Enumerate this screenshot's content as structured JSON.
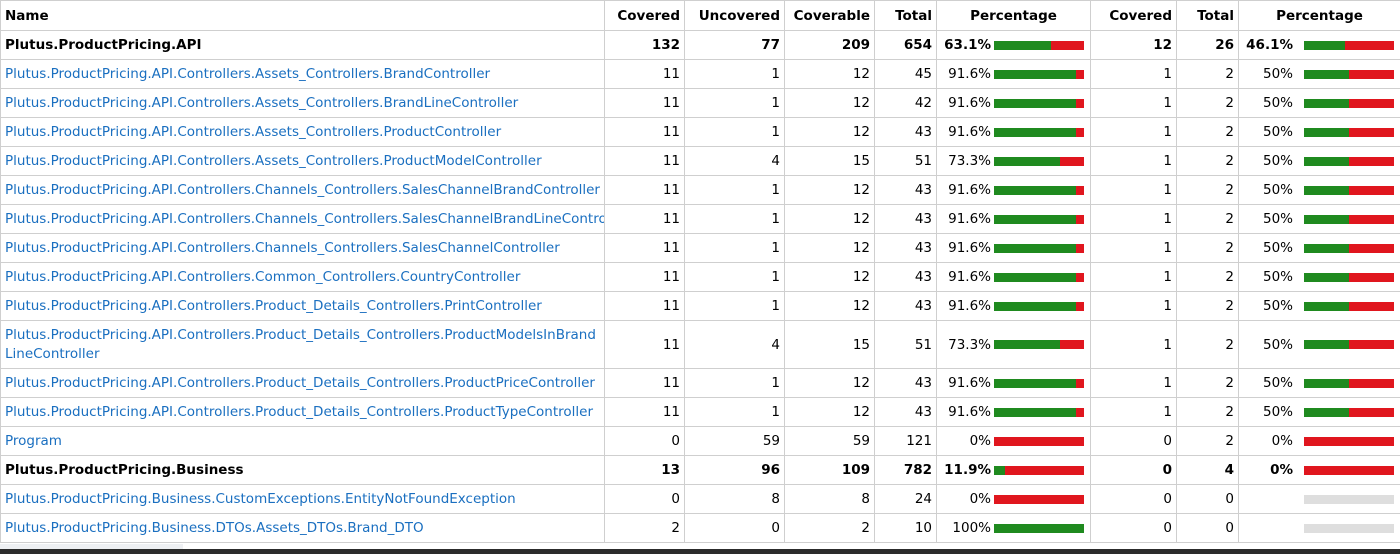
{
  "colors": {
    "covered": "#1f8a1f",
    "uncovered": "#e0161e",
    "link": "#1a6fc0",
    "empty": "#dedede"
  },
  "headers": [
    "Name",
    "Covered",
    "Uncovered",
    "Coverable",
    "Total",
    "Percentage",
    "Covered",
    "Total",
    "Percentage"
  ],
  "rows": [
    {
      "type": "assembly",
      "name": "Plutus.ProductPricing.API",
      "covered": "132",
      "uncovered": "77",
      "coverable": "209",
      "total": "654",
      "pct": "63.1%",
      "pct_value": 63.1,
      "b_covered": "12",
      "b_total": "26",
      "b_pct": "46.1%",
      "b_pct_value": 46.1
    },
    {
      "type": "class",
      "name": "Plutus.ProductPricing.API.Controllers.Assets_Controllers.BrandController",
      "covered": "11",
      "uncovered": "1",
      "coverable": "12",
      "total": "45",
      "pct": "91.6%",
      "pct_value": 91.6,
      "b_covered": "1",
      "b_total": "2",
      "b_pct": "50%",
      "b_pct_value": 50
    },
    {
      "type": "class",
      "name": "Plutus.ProductPricing.API.Controllers.Assets_Controllers.BrandLineController",
      "covered": "11",
      "uncovered": "1",
      "coverable": "12",
      "total": "42",
      "pct": "91.6%",
      "pct_value": 91.6,
      "b_covered": "1",
      "b_total": "2",
      "b_pct": "50%",
      "b_pct_value": 50
    },
    {
      "type": "class",
      "name": "Plutus.ProductPricing.API.Controllers.Assets_Controllers.ProductController",
      "covered": "11",
      "uncovered": "1",
      "coverable": "12",
      "total": "43",
      "pct": "91.6%",
      "pct_value": 91.6,
      "b_covered": "1",
      "b_total": "2",
      "b_pct": "50%",
      "b_pct_value": 50
    },
    {
      "type": "class",
      "name": "Plutus.ProductPricing.API.Controllers.Assets_Controllers.ProductModelController",
      "covered": "11",
      "uncovered": "4",
      "coverable": "15",
      "total": "51",
      "pct": "73.3%",
      "pct_value": 73.3,
      "b_covered": "1",
      "b_total": "2",
      "b_pct": "50%",
      "b_pct_value": 50
    },
    {
      "type": "class",
      "name": "Plutus.ProductPricing.API.Controllers.Channels_Controllers.SalesChannelBrandController",
      "covered": "11",
      "uncovered": "1",
      "coverable": "12",
      "total": "43",
      "pct": "91.6%",
      "pct_value": 91.6,
      "b_covered": "1",
      "b_total": "2",
      "b_pct": "50%",
      "b_pct_value": 50
    },
    {
      "type": "class",
      "name": "Plutus.ProductPricing.API.Controllers.Channels_Controllers.SalesChannelBrandLineController",
      "covered": "11",
      "uncovered": "1",
      "coverable": "12",
      "total": "43",
      "pct": "91.6%",
      "pct_value": 91.6,
      "b_covered": "1",
      "b_total": "2",
      "b_pct": "50%",
      "b_pct_value": 50
    },
    {
      "type": "class",
      "name": "Plutus.ProductPricing.API.Controllers.Channels_Controllers.SalesChannelController",
      "covered": "11",
      "uncovered": "1",
      "coverable": "12",
      "total": "43",
      "pct": "91.6%",
      "pct_value": 91.6,
      "b_covered": "1",
      "b_total": "2",
      "b_pct": "50%",
      "b_pct_value": 50
    },
    {
      "type": "class",
      "name": "Plutus.ProductPricing.API.Controllers.Common_Controllers.CountryController",
      "covered": "11",
      "uncovered": "1",
      "coverable": "12",
      "total": "43",
      "pct": "91.6%",
      "pct_value": 91.6,
      "b_covered": "1",
      "b_total": "2",
      "b_pct": "50%",
      "b_pct_value": 50
    },
    {
      "type": "class",
      "name": "Plutus.ProductPricing.API.Controllers.Product_Details_Controllers.PrintController",
      "covered": "11",
      "uncovered": "1",
      "coverable": "12",
      "total": "43",
      "pct": "91.6%",
      "pct_value": 91.6,
      "b_covered": "1",
      "b_total": "2",
      "b_pct": "50%",
      "b_pct_value": 50
    },
    {
      "type": "class",
      "tall": true,
      "name": "Plutus.ProductPricing.API.Controllers.Product_Details_Controllers.ProductModelsInBrandLineController",
      "covered": "11",
      "uncovered": "4",
      "coverable": "15",
      "total": "51",
      "pct": "73.3%",
      "pct_value": 73.3,
      "b_covered": "1",
      "b_total": "2",
      "b_pct": "50%",
      "b_pct_value": 50
    },
    {
      "type": "class",
      "name": "Plutus.ProductPricing.API.Controllers.Product_Details_Controllers.ProductPriceController",
      "covered": "11",
      "uncovered": "1",
      "coverable": "12",
      "total": "43",
      "pct": "91.6%",
      "pct_value": 91.6,
      "b_covered": "1",
      "b_total": "2",
      "b_pct": "50%",
      "b_pct_value": 50
    },
    {
      "type": "class",
      "name": "Plutus.ProductPricing.API.Controllers.Product_Details_Controllers.ProductTypeController",
      "covered": "11",
      "uncovered": "1",
      "coverable": "12",
      "total": "43",
      "pct": "91.6%",
      "pct_value": 91.6,
      "b_covered": "1",
      "b_total": "2",
      "b_pct": "50%",
      "b_pct_value": 50
    },
    {
      "type": "class",
      "name": "Program",
      "covered": "0",
      "uncovered": "59",
      "coverable": "59",
      "total": "121",
      "pct": "0%",
      "pct_value": 0,
      "b_covered": "0",
      "b_total": "2",
      "b_pct": "0%",
      "b_pct_value": 0
    },
    {
      "type": "assembly",
      "name": "Plutus.ProductPricing.Business",
      "covered": "13",
      "uncovered": "96",
      "coverable": "109",
      "total": "782",
      "pct": "11.9%",
      "pct_value": 11.9,
      "b_covered": "0",
      "b_total": "4",
      "b_pct": "0%",
      "b_pct_value": 0
    },
    {
      "type": "class",
      "name": "Plutus.ProductPricing.Business.CustomExceptions.EntityNotFoundException",
      "covered": "0",
      "uncovered": "8",
      "coverable": "8",
      "total": "24",
      "pct": "0%",
      "pct_value": 0,
      "b_covered": "0",
      "b_total": "0",
      "b_pct": "",
      "b_pct_value": null
    },
    {
      "type": "class",
      "name": "Plutus.ProductPricing.Business.DTOs.Assets_DTOs.Brand_DTO",
      "covered": "2",
      "uncovered": "0",
      "coverable": "2",
      "total": "10",
      "pct": "100%",
      "pct_value": 100,
      "b_covered": "0",
      "b_total": "0",
      "b_pct": "",
      "b_pct_value": null
    }
  ]
}
